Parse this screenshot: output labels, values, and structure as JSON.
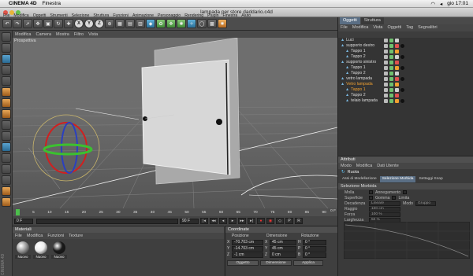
{
  "mac_menu": {
    "app_name": "CINEMA 4D",
    "items": [
      "Finestra"
    ],
    "clock": "gio 17:01"
  },
  "window": {
    "title": "lampada per store daddario.c4d"
  },
  "main_menu": [
    "File",
    "Modifica",
    "Oggetti",
    "Strumenti",
    "Selezione",
    "Struttura",
    "Funzioni",
    "Animazione",
    "Personaggio",
    "Rendering",
    "Plugin",
    "Finestra",
    "Aiuto"
  ],
  "toolbar": {
    "axis_x": "X",
    "axis_y": "Y",
    "axis_z": "Z"
  },
  "viewport": {
    "menu": [
      "Modifica",
      "Camera",
      "Mostra",
      "Filtro",
      "Vista"
    ],
    "label": "Prospettiva"
  },
  "timeline": {
    "ticks": [
      "0",
      "5",
      "10",
      "15",
      "20",
      "25",
      "30",
      "35",
      "40",
      "45",
      "50",
      "55",
      "60",
      "65",
      "70",
      "75",
      "80",
      "85",
      "90"
    ],
    "current_frame": "0 F",
    "start_field": "0 F",
    "end_field": "90 F"
  },
  "materials": {
    "title": "Materiali",
    "menu": [
      "File",
      "Modifica",
      "Funzioni",
      "Texture"
    ],
    "items": [
      {
        "name": "Nuovo",
        "color": "#9a9a9a"
      },
      {
        "name": "Nuovo",
        "color": "#ececec"
      },
      {
        "name": "Nuovo",
        "color": "#1a1a1a"
      }
    ]
  },
  "coordinates": {
    "title": "Coordinate",
    "col_position": "Posizione",
    "col_dimension": "Dimensione",
    "col_rotation": "Rotazione",
    "rows": [
      {
        "axis": "X",
        "pos": "-70.703 cm",
        "dim": "45 cm",
        "rot_axis": "H",
        "rot": "0 °"
      },
      {
        "axis": "Y",
        "pos": "-14.703 cm",
        "dim": "45 cm",
        "rot_axis": "P",
        "rot": "0 °"
      },
      {
        "axis": "Z",
        "pos": "-1 cm",
        "dim": "0 cm",
        "rot_axis": "B",
        "rot": "0 °"
      }
    ],
    "select_object": "Oggetto",
    "select_dimension": "Dimensione",
    "apply": "Applica"
  },
  "object_manager": {
    "tabs": [
      "Oggetti",
      "Struttura"
    ],
    "menu": [
      "File",
      "Modifica",
      "Vista",
      "Oggetti",
      "Tag",
      "Segnalibri"
    ],
    "objects": [
      {
        "name": "Luci",
        "indent": 0,
        "selected": false
      },
      {
        "name": "supporto destro",
        "indent": 0,
        "selected": false
      },
      {
        "name": "Tappo 1",
        "indent": 1,
        "selected": false
      },
      {
        "name": "Tappo 2",
        "indent": 1,
        "selected": false
      },
      {
        "name": "supporto sinistro",
        "indent": 0,
        "selected": false
      },
      {
        "name": "Tappo 1",
        "indent": 1,
        "selected": false
      },
      {
        "name": "Tappo 2",
        "indent": 1,
        "selected": false
      },
      {
        "name": "vetro lampada",
        "indent": 0,
        "selected": false
      },
      {
        "name": "Vetro lampada",
        "indent": 0,
        "selected": true
      },
      {
        "name": "Tappo 1",
        "indent": 1,
        "selected": true
      },
      {
        "name": "Tappo 2",
        "indent": 1,
        "selected": false
      },
      {
        "name": "telaio lampada",
        "indent": 1,
        "selected": false
      }
    ]
  },
  "attributes": {
    "title": "Attributi",
    "menu": [
      "Modo",
      "Modifica",
      "Dati Utente"
    ],
    "tool_name": "Ruota",
    "tabs": [
      "Assi di Modellazione",
      "Selezione Morbida",
      "Settaggi Snap"
    ],
    "section": "Selezione Morbida",
    "rows": [
      {
        "label": "Molla",
        "extra": "Annegamento"
      },
      {
        "label": "Superficie",
        "extra": "Gomma",
        "extra2": "Limita"
      },
      {
        "label": "Decadenza",
        "value": "Lineare",
        "extra": "Modo",
        "value2": "Gruppo"
      },
      {
        "label": "Raggio",
        "value": "100 cm"
      },
      {
        "label": "Forza",
        "value": "100 %"
      },
      {
        "label": "Larghezza",
        "value": "50 %"
      }
    ]
  },
  "colors": {
    "accent": "#5a6e84",
    "selection_orange": "#f0a030",
    "viewport_bg": "#6d6d6d"
  }
}
